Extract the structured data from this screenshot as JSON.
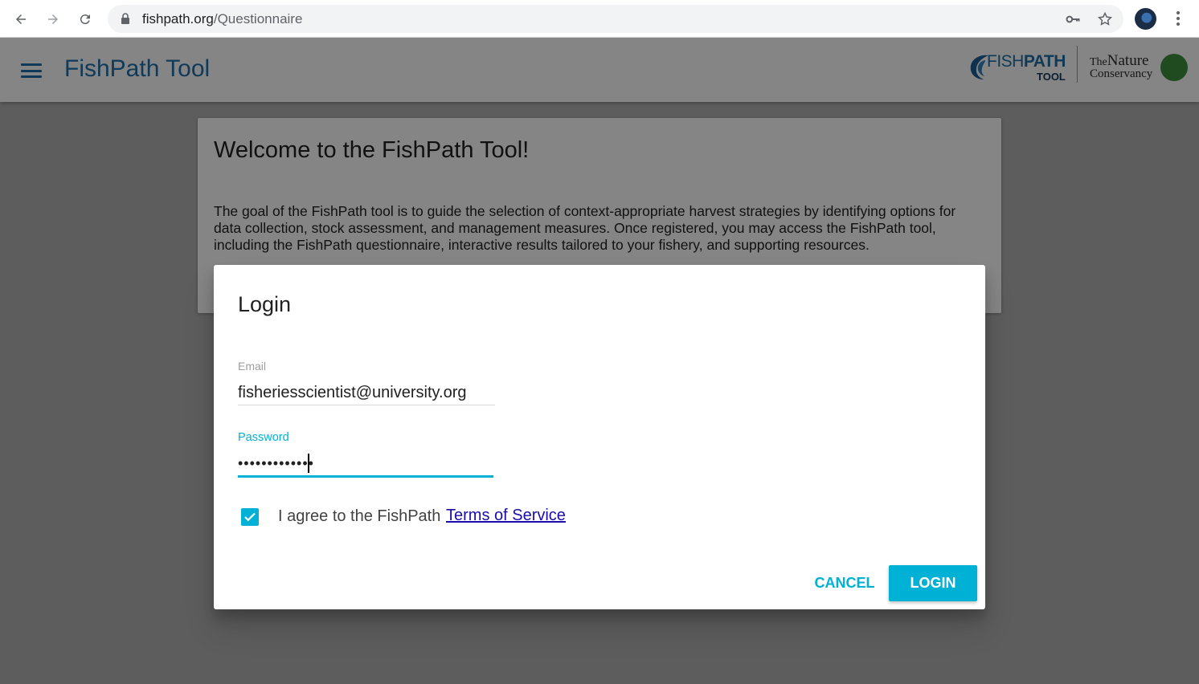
{
  "browser": {
    "url_domain": "fishpath.org",
    "url_path": "/Questionnaire"
  },
  "app": {
    "title": "FishPath Tool",
    "logo_fishpath_word_light": "FISH",
    "logo_fishpath_word_bold": "PATH",
    "logo_fishpath_sub": "TOOL",
    "logo_tnc_the": "The",
    "logo_tnc_nature": "Nature",
    "logo_tnc_conservancy": "Conservancy"
  },
  "welcome": {
    "title": "Welcome to the FishPath Tool!",
    "body": "The goal of the FishPath tool is to guide the selection of context-appropriate harvest strategies by identifying options for data collection, stock assessment, and management measures. Once registered, you may access the FishPath tool, including the FishPath questionnaire, interactive results tailored to your fishery, and supporting resources."
  },
  "login_dialog": {
    "title": "Login",
    "email_label": "Email",
    "email_value": "fisheriesscientist@university.org",
    "password_label": "Password",
    "password_value": "•••••••••••••",
    "agree_text": "I agree to the FishPath",
    "terms_link": "Terms of Service",
    "agree_checked": true,
    "cancel_label": "CANCEL",
    "login_label": "LOGIN"
  },
  "colors": {
    "accent": "#00b1d6",
    "app_title": "#1f6fa8",
    "link": "#1a0dab"
  },
  "icons": [
    "back-arrow-icon",
    "forward-arrow-icon",
    "reload-icon",
    "lock-icon",
    "key-icon",
    "star-icon",
    "profile-avatar",
    "menu-dots-icon",
    "hamburger-menu-icon",
    "check-icon"
  ]
}
